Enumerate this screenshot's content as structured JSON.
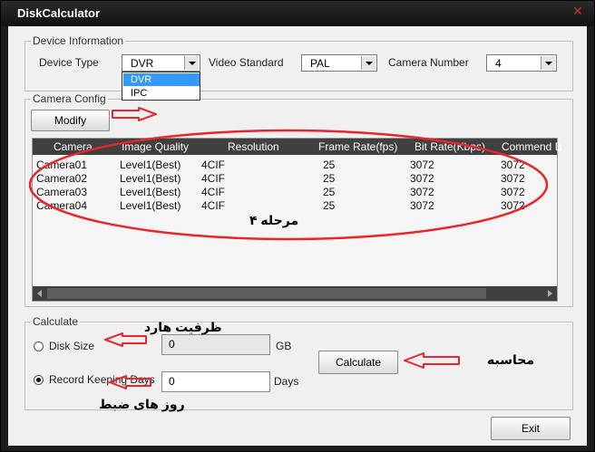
{
  "window": {
    "title": "DiskCalculator"
  },
  "device_info": {
    "legend": "Device Information",
    "device_type_label": "Device Type",
    "device_type_value": "DVR",
    "device_type_options": [
      "DVR",
      "IPC"
    ],
    "video_standard_label": "Video Standard",
    "video_standard_value": "PAL",
    "camera_number_label": "Camera Number",
    "camera_number_value": "4"
  },
  "camera_config": {
    "legend": "Camera Config",
    "modify_label": "Modify",
    "columns": [
      "Camera",
      "Image Quality",
      "Resolution",
      "Frame Rate(fps)",
      "Bit Rate(Kbps)",
      "Commend B"
    ],
    "rows": [
      [
        "Camera01",
        "Level1(Best)",
        "4CIF",
        "25",
        "3072",
        "3072"
      ],
      [
        "Camera02",
        "Level1(Best)",
        "4CIF",
        "25",
        "3072",
        "3072"
      ],
      [
        "Camera03",
        "Level1(Best)",
        "4CIF",
        "25",
        "3072",
        "3072"
      ],
      [
        "Camera04",
        "Level1(Best)",
        "4CIF",
        "25",
        "3072",
        "3072"
      ]
    ]
  },
  "calculate": {
    "legend": "Calculate",
    "disk_size_label": "Disk Size",
    "disk_size_value": "0",
    "disk_size_unit": "GB",
    "record_label": "Record Keeping Days",
    "record_value": "0",
    "record_unit": "Days",
    "calculate_label": "Calculate",
    "selected": "record"
  },
  "exit_label": "Exit",
  "annotations": {
    "step4": "مرحله ۴",
    "hard_capacity": "ظرفیت هارد",
    "record_days": "روز های ضبط",
    "calculate": "محاسبه"
  },
  "colors": {
    "annotation": "#e8252a",
    "selection": "#3399ff"
  }
}
